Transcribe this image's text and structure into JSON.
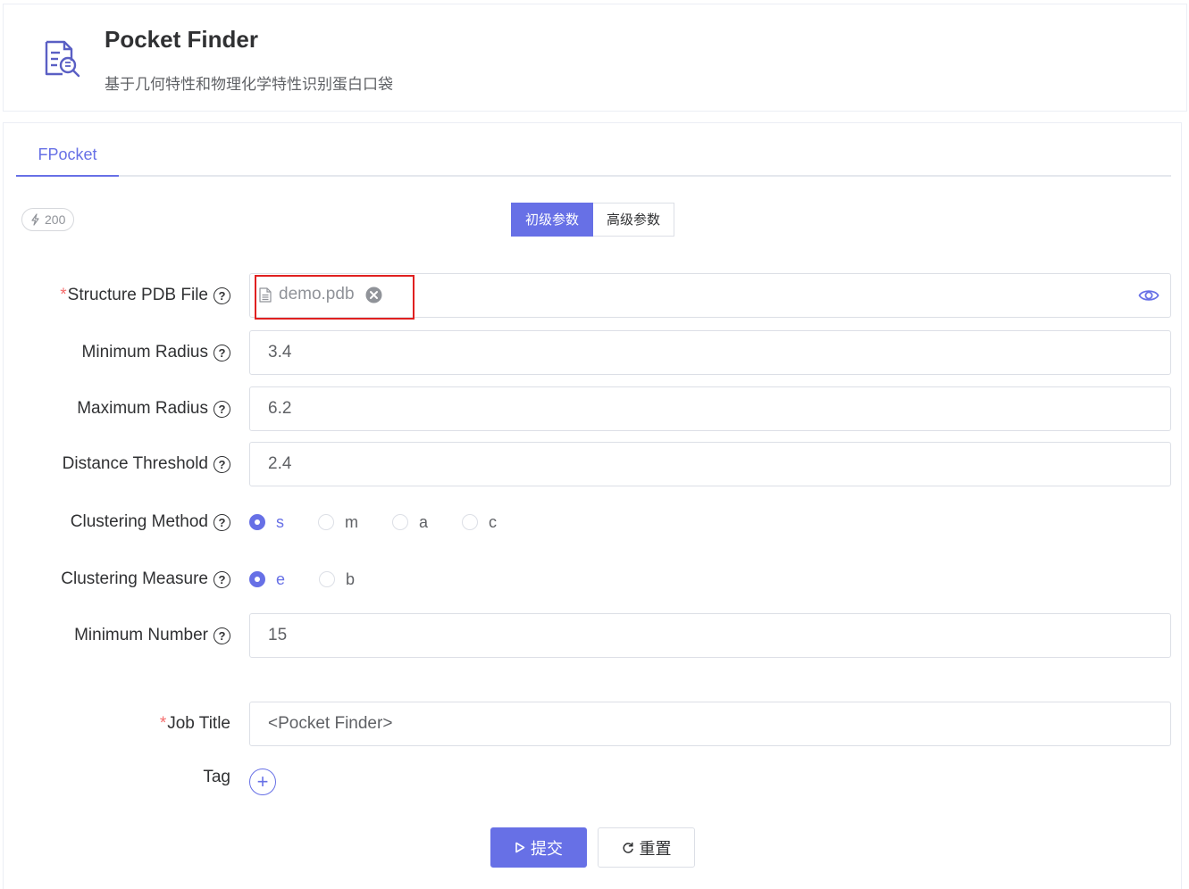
{
  "app": {
    "title": "Pocket Finder",
    "subtitle": "基于几何特性和物理化学特性识别蛋白口袋"
  },
  "tabs": [
    {
      "label": "FPocket",
      "active": true
    }
  ],
  "credits": {
    "value": "200"
  },
  "param_modes": [
    {
      "label": "初级参数",
      "active": true
    },
    {
      "label": "高级参数",
      "active": false
    }
  ],
  "form": {
    "structure_file": {
      "label": "Structure PDB File",
      "required": true,
      "file_name": "demo.pdb"
    },
    "min_radius": {
      "label": "Minimum Radius",
      "value": "3.4"
    },
    "max_radius": {
      "label": "Maximum Radius",
      "value": "6.2"
    },
    "distance_threshold": {
      "label": "Distance Threshold",
      "value": "2.4"
    },
    "clustering_method": {
      "label": "Clustering Method",
      "options": [
        "s",
        "m",
        "a",
        "c"
      ],
      "selected": "s"
    },
    "clustering_measure": {
      "label": "Clustering Measure",
      "options": [
        "e",
        "b"
      ],
      "selected": "e"
    },
    "min_number": {
      "label": "Minimum Number",
      "value": "15"
    },
    "job_title": {
      "label": "Job Title",
      "required": true,
      "value": "<Pocket Finder>"
    },
    "tag": {
      "label": "Tag"
    }
  },
  "actions": {
    "submit_label": "提交",
    "reset_label": "重置"
  },
  "colors": {
    "accent": "#6770e6",
    "required": "#f56c6c",
    "highlight": "#e02020"
  }
}
